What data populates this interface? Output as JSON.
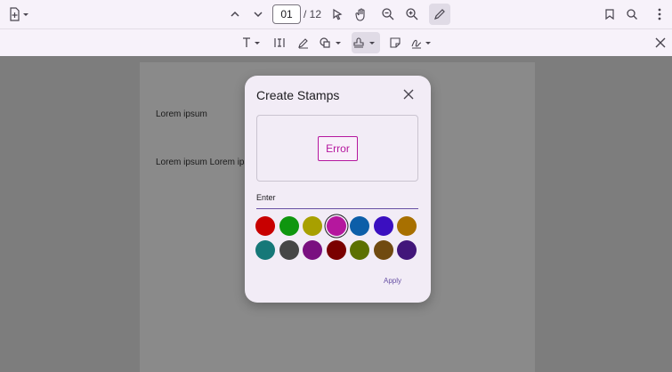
{
  "toolbar": {
    "page_current": "01",
    "page_total": "/ 12"
  },
  "document": {
    "lines": [
      "Lorem ipsum",
      "Lorem ipsum Lorem ipsu"
    ]
  },
  "dialog": {
    "title": "Create Stamps",
    "stamp_text": "Error",
    "stamp_color": "#b5179e",
    "input_value": "Enter",
    "apply_label": "Apply",
    "colors": [
      {
        "hex": "#c80000",
        "selected": false
      },
      {
        "hex": "#0f960f",
        "selected": false
      },
      {
        "hex": "#a8a000",
        "selected": false
      },
      {
        "hex": "#b5179e",
        "selected": true
      },
      {
        "hex": "#0d5ea8",
        "selected": false
      },
      {
        "hex": "#3b0fc0",
        "selected": false
      },
      {
        "hex": "#a87000",
        "selected": false
      },
      {
        "hex": "#167878",
        "selected": false
      },
      {
        "hex": "#464646",
        "selected": false
      },
      {
        "hex": "#7a1080",
        "selected": false
      },
      {
        "hex": "#7a0000",
        "selected": false
      },
      {
        "hex": "#5c7000",
        "selected": false
      },
      {
        "hex": "#704a10",
        "selected": false
      },
      {
        "hex": "#42167a",
        "selected": false
      }
    ]
  }
}
